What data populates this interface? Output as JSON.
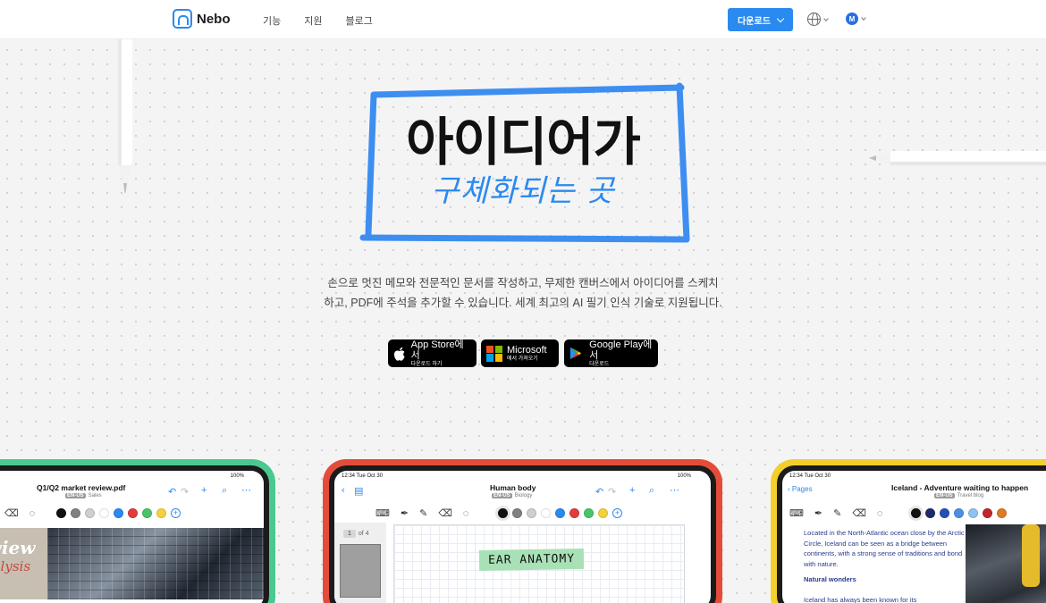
{
  "nav": {
    "logo_text": "Nebo",
    "links": [
      "기능",
      "지원",
      "블로그"
    ],
    "download_label": "다운로드",
    "avatar_letter": "M"
  },
  "hero": {
    "title": "아이디어가",
    "subtitle": "구체화되는 곳",
    "description_line1": "손으로 멋진 메모와 전문적인 문서를 작성하고, 무제한 캔버스에서 아이디어를 스케치",
    "description_line2": "하고, PDF에 주석을 추가할 수 있습니다. 세계 최고의 AI 필기 인식 기술로 지원됩니다."
  },
  "stores": {
    "apple_big": "App Store에서",
    "apple_small": "다운로드 하기",
    "ms_big": "Microsoft",
    "ms_small": "에서 가져오기",
    "gp_big": "Google Play에서",
    "gp_small": "다운로드"
  },
  "devices": {
    "left": {
      "battery": "100%",
      "title": "Q1/Q2 market review.pdf",
      "tag": "EN-US",
      "category": "Sales",
      "img_word1": "review",
      "img_word2": "analysis",
      "colors": [
        "#111111",
        "#808080",
        "#cfcfcf",
        "#ffffff",
        "#2b8aef",
        "#e23b3b",
        "#48c46a",
        "#f5d23a"
      ]
    },
    "mid": {
      "time": "12:34   Tue Oct 30",
      "battery": "100%",
      "title": "Human body",
      "tag": "EN-US",
      "category": "Biology",
      "page_current": "1",
      "page_total": "of 4",
      "note": "EAR ANATOMY",
      "colors": [
        "#111111",
        "#808080",
        "#cfcfcf",
        "#ffffff",
        "#2b8aef",
        "#e23b3b",
        "#48c46a",
        "#f5d23a"
      ]
    },
    "right": {
      "time": "12:34   Tue Oct 30",
      "back_label": "Pages",
      "title": "Iceland - Adventure waiting to happen",
      "tag": "EN-US",
      "category": "Travel blog",
      "para": "Located in the North-Atlantic ocean close by the Arctic Circle, Iceland can be seen as a bridge between continents, with a strong sense of traditions and bond with nature.",
      "heading": "Natural wonders",
      "para2": "Iceland has always been known for its",
      "colors": [
        "#111111",
        "#1f2a6b",
        "#2450b3",
        "#4a90e2",
        "#8ec3f0",
        "#c0262c",
        "#e07a24"
      ]
    }
  }
}
